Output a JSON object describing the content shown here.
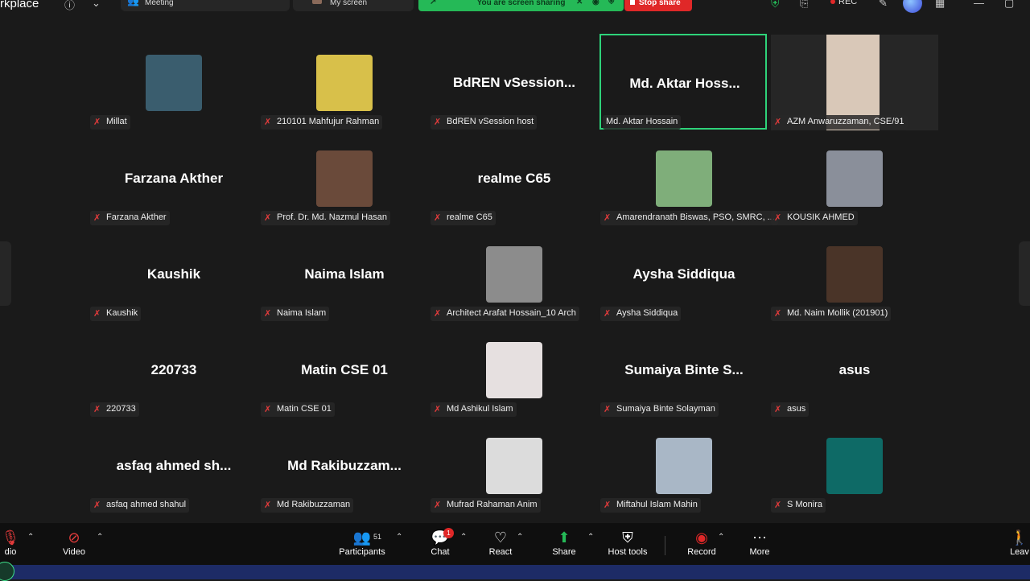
{
  "app": {
    "title": "rkplace"
  },
  "topbar": {
    "meeting_tab": "Meeting",
    "screen_tab": "My screen",
    "share_banner": "You are screen sharing",
    "stop_share": "Stop share",
    "rec": "REC"
  },
  "tiles": [
    {
      "big": "",
      "label": "Millat",
      "photo": "#3a5d6e",
      "active": false
    },
    {
      "big": "",
      "label": "210101 Mahfujur Rahman",
      "photo": "#d8c04a",
      "active": false
    },
    {
      "big": "BdREN  vSession...",
      "label": "BdREN vSession host",
      "photo": "",
      "active": false
    },
    {
      "big": "Md.  Aktar Hoss...",
      "label": "Md. Aktar Hossain",
      "photo": "",
      "active": true
    },
    {
      "big": "",
      "label": "AZM Anwaruzzaman, CSE/91",
      "photo": "#d9c8b8",
      "active": false
    },
    {
      "big": "Farzana Akther",
      "label": "Farzana Akther",
      "photo": "",
      "active": false
    },
    {
      "big": "",
      "label": "Prof. Dr. Md. Nazmul Hasan",
      "photo": "#6a4a3a",
      "active": false
    },
    {
      "big": "realme C65",
      "label": "realme C65",
      "photo": "",
      "active": false
    },
    {
      "big": "",
      "label": "Amarendranath Biswas, PSO, SMRC, ...",
      "photo": "#7fae7a",
      "active": false
    },
    {
      "big": "",
      "label": "KOUSIK AHMED",
      "photo": "#8a8f9a",
      "active": false
    },
    {
      "big": "Kaushik",
      "label": "Kaushik",
      "photo": "",
      "active": false
    },
    {
      "big": "Naima Islam",
      "label": "Naima Islam",
      "photo": "",
      "active": false
    },
    {
      "big": "",
      "label": "Architect Arafat Hossain_10 Arch",
      "photo": "#8c8c8c",
      "active": false
    },
    {
      "big": "Aysha Siddiqua",
      "label": "Aysha Siddiqua",
      "photo": "",
      "active": false
    },
    {
      "big": "",
      "label": "Md. Naim Mollik (201901)",
      "photo": "#4a3428",
      "active": false
    },
    {
      "big": "220733",
      "label": "220733",
      "photo": "",
      "active": false
    },
    {
      "big": "Matin CSE 01",
      "label": "Matin CSE 01",
      "photo": "",
      "active": false
    },
    {
      "big": "",
      "label": "Md Ashikul Islam",
      "photo": "#e6e0e0",
      "active": false
    },
    {
      "big": "Sumaiya Binte S...",
      "label": "Sumaiya Binte Solayman",
      "photo": "",
      "active": false
    },
    {
      "big": "asus",
      "label": "asus",
      "photo": "",
      "active": false
    },
    {
      "big": "asfaq  ahmed  sh...",
      "label": "asfaq ahmed shahul",
      "photo": "",
      "active": false
    },
    {
      "big": "Md  Rakibuzzam...",
      "label": "Md Rakibuzzaman",
      "photo": "",
      "active": false
    },
    {
      "big": "",
      "label": "Mufrad Rahaman Anim",
      "photo": "#dcdcdc",
      "active": false
    },
    {
      "big": "",
      "label": "Miftahul Islam Mahin",
      "photo": "#a9b7c6",
      "active": false
    },
    {
      "big": "",
      "label": "S Monira",
      "photo": "#0e6a66",
      "active": false
    }
  ],
  "toolbar": {
    "audio": "dio",
    "video": "Video",
    "participants": "Participants",
    "participants_count": "51",
    "chat": "Chat",
    "chat_badge": "1",
    "react": "React",
    "share": "Share",
    "host_tools": "Host tools",
    "record": "Record",
    "more": "More",
    "leave": "Leav"
  }
}
